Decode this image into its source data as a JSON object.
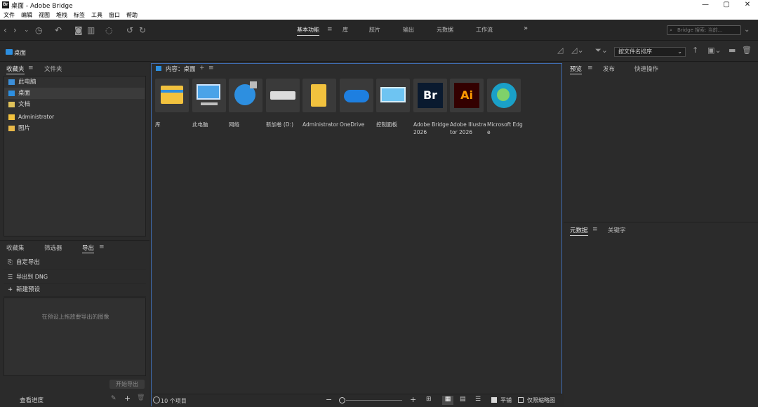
{
  "window": {
    "title": "桌面 - Adobe Bridge",
    "logo": "Br",
    "controls": [
      "—",
      "▢",
      "✕"
    ]
  },
  "menu": [
    "文件",
    "编辑",
    "视图",
    "堆栈",
    "标签",
    "工具",
    "窗口",
    "帮助"
  ],
  "workspaces": [
    {
      "label": "基本功能",
      "active": true
    },
    {
      "label": "库",
      "active": false
    },
    {
      "label": "胶片",
      "active": false
    },
    {
      "label": "输出",
      "active": false
    },
    {
      "label": "元数据",
      "active": false
    },
    {
      "label": "工作流",
      "active": false
    }
  ],
  "toolbar": {
    "more": "»",
    "search_placeholder": "Bridge 搜索: 当前..."
  },
  "pathbar": {
    "location": "桌面",
    "sort_label": "按文件名排序"
  },
  "left_top": {
    "tabs": [
      {
        "label": "收藏夹",
        "active": true
      },
      {
        "label": "文件夹",
        "active": false
      }
    ],
    "items": [
      {
        "label": "此电脑",
        "icon": "computer-icon",
        "selected": false
      },
      {
        "label": "桌面",
        "icon": "desktop-icon",
        "selected": true
      },
      {
        "label": "文档",
        "icon": "document-icon",
        "selected": false
      },
      {
        "label": "Administrator",
        "icon": "folder-icon",
        "selected": false
      },
      {
        "label": "图片",
        "icon": "pictures-icon",
        "selected": false
      }
    ]
  },
  "left_bottom": {
    "tabs": [
      {
        "label": "收藏集",
        "active": false
      },
      {
        "label": "筛选器",
        "active": false
      },
      {
        "label": "导出",
        "active": true
      }
    ],
    "rows": [
      {
        "label": "自定导出",
        "icon": "export-icon"
      },
      {
        "label": "导出到 DNG",
        "icon": "list-icon"
      },
      {
        "label": "新建预设",
        "icon": "plus-icon"
      }
    ],
    "drop_hint": "在预设上拖放要导出的图像",
    "start_export": "开始导出",
    "view_progress": "查看进度"
  },
  "content": {
    "header": "内容：桌面",
    "items": [
      {
        "label": "库",
        "kind": "library"
      },
      {
        "label": "此电脑",
        "kind": "computer"
      },
      {
        "label": "网络",
        "kind": "network"
      },
      {
        "label": "新加卷 (D:)",
        "kind": "drive"
      },
      {
        "label": "Administrator",
        "kind": "folder"
      },
      {
        "label": "OneDrive",
        "kind": "cloud"
      },
      {
        "label": "控制面板",
        "kind": "control"
      },
      {
        "label": "Adobe Bridge 2026",
        "kind": "bridge"
      },
      {
        "label": "Adobe Illustrator 2026",
        "kind": "illustrator"
      },
      {
        "label": "Microsoft Edge",
        "kind": "edge"
      }
    ],
    "status": "10 个项目",
    "tile_label": "平铺",
    "thumbs_only_label": "仅限缩略图"
  },
  "right_top": {
    "tabs": [
      {
        "label": "预览",
        "active": true
      },
      {
        "label": "发布",
        "active": false
      },
      {
        "label": "快速操作",
        "active": false
      }
    ]
  },
  "right_bottom": {
    "tabs": [
      {
        "label": "元数据",
        "active": true
      },
      {
        "label": "关键字",
        "active": false
      }
    ]
  },
  "colors": {
    "accent": "#3f6cb0",
    "folder": "#f2c23e",
    "bridge": "#0a1a2f",
    "illustrator": "#330000"
  }
}
